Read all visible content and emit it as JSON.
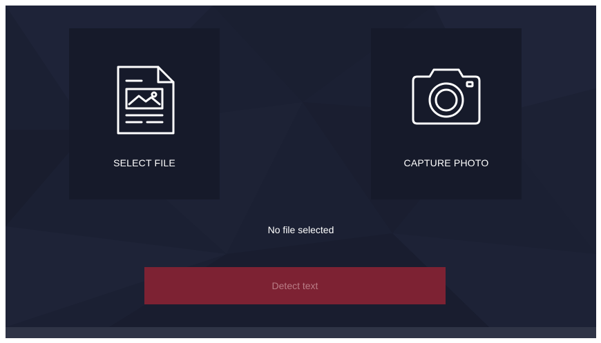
{
  "tiles": {
    "select_file": {
      "label": "SELECT FILE",
      "icon": "document-image-icon"
    },
    "capture_photo": {
      "label": "CAPTURE PHOTO",
      "icon": "camera-icon"
    }
  },
  "status": {
    "text": "No file selected"
  },
  "detect_button": {
    "label": "Detect text",
    "state": "disabled"
  },
  "colors": {
    "background": "#1b2033",
    "tile": "#161a2a",
    "button": "#7d2233",
    "button_text": "#b97c86",
    "bottom_bar": "#2f3446"
  }
}
